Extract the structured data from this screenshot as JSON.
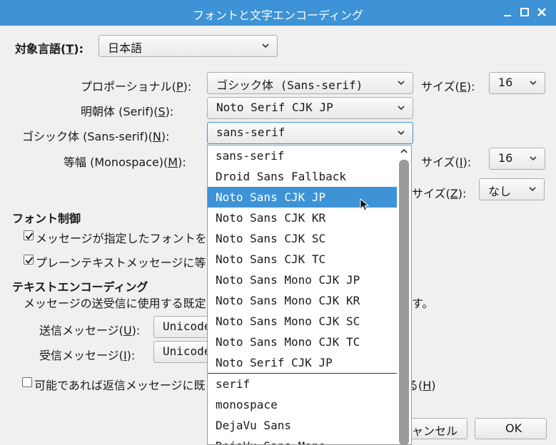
{
  "window": {
    "title": "フォントと文字エンコーディング"
  },
  "language": {
    "label_pre": "対象言語(",
    "label_key": "T",
    "label_post": "):",
    "value": "日本語"
  },
  "fonts": {
    "proportional": {
      "label_pre": "プロポーショナル(",
      "label_key": "P",
      "label_post": "):",
      "value": "ゴシック体 (Sans-serif)"
    },
    "size1": {
      "label_pre": "サイズ(",
      "label_key": "E",
      "label_post": "):",
      "value": "16"
    },
    "serif": {
      "label_pre": "明朝体 (Serif)(",
      "label_key": "S",
      "label_post": "):",
      "value": "Noto Serif CJK JP"
    },
    "sans": {
      "label_pre": "ゴシック体 (Sans-serif)(",
      "label_key": "N",
      "label_post": "):",
      "value": "sans-serif"
    },
    "mono": {
      "label_pre": "等幅 (Monospace)(",
      "label_key": "M",
      "label_post": "):"
    },
    "size2": {
      "label_pre": "サイズ(",
      "label_key": "I",
      "label_post": "):",
      "value": "16"
    },
    "min_size": {
      "label_visible": "サイズ(",
      "label_key": "Z",
      "label_post": "):",
      "value": "なし"
    }
  },
  "font_control": {
    "heading": "フォント制御",
    "check1": "メッセージが指定したフォントを",
    "check2": "プレーンテキストメッセージに等"
  },
  "encoding": {
    "heading": "テキストエンコーディング",
    "desc_pre": "メッセージの送受信に使用する既定",
    "desc_post": "す。",
    "send": {
      "label_pre": "送信メッセージ(",
      "label_key": "U",
      "label_post": "):",
      "value": "Unicode"
    },
    "recv": {
      "label_pre": "受信メッセージ(",
      "label_key": "I",
      "label_post": "):",
      "value": "Unicode"
    },
    "reply_pre": "可能であれば返信メッセージに既",
    "reply_post_pre": "る(",
    "reply_key": "H",
    "reply_post": ")"
  },
  "buttons": {
    "cancel": "ャンセル",
    "ok": "OK"
  },
  "dropdown": {
    "items": [
      "sans-serif",
      "Droid Sans Fallback",
      "Noto Sans CJK JP",
      "Noto Sans CJK KR",
      "Noto Sans CJK SC",
      "Noto Sans CJK TC",
      "Noto Sans Mono CJK JP",
      "Noto Sans Mono CJK KR",
      "Noto Sans Mono CJK SC",
      "Noto Sans Mono CJK TC",
      "Noto Serif CJK JP",
      "serif",
      "monospace",
      "DejaVu Sans",
      "DejaVu Sans Mono"
    ],
    "selected_index": 2
  },
  "colors": {
    "titlebar": "#3d93d6",
    "selection": "#3d93d6"
  }
}
